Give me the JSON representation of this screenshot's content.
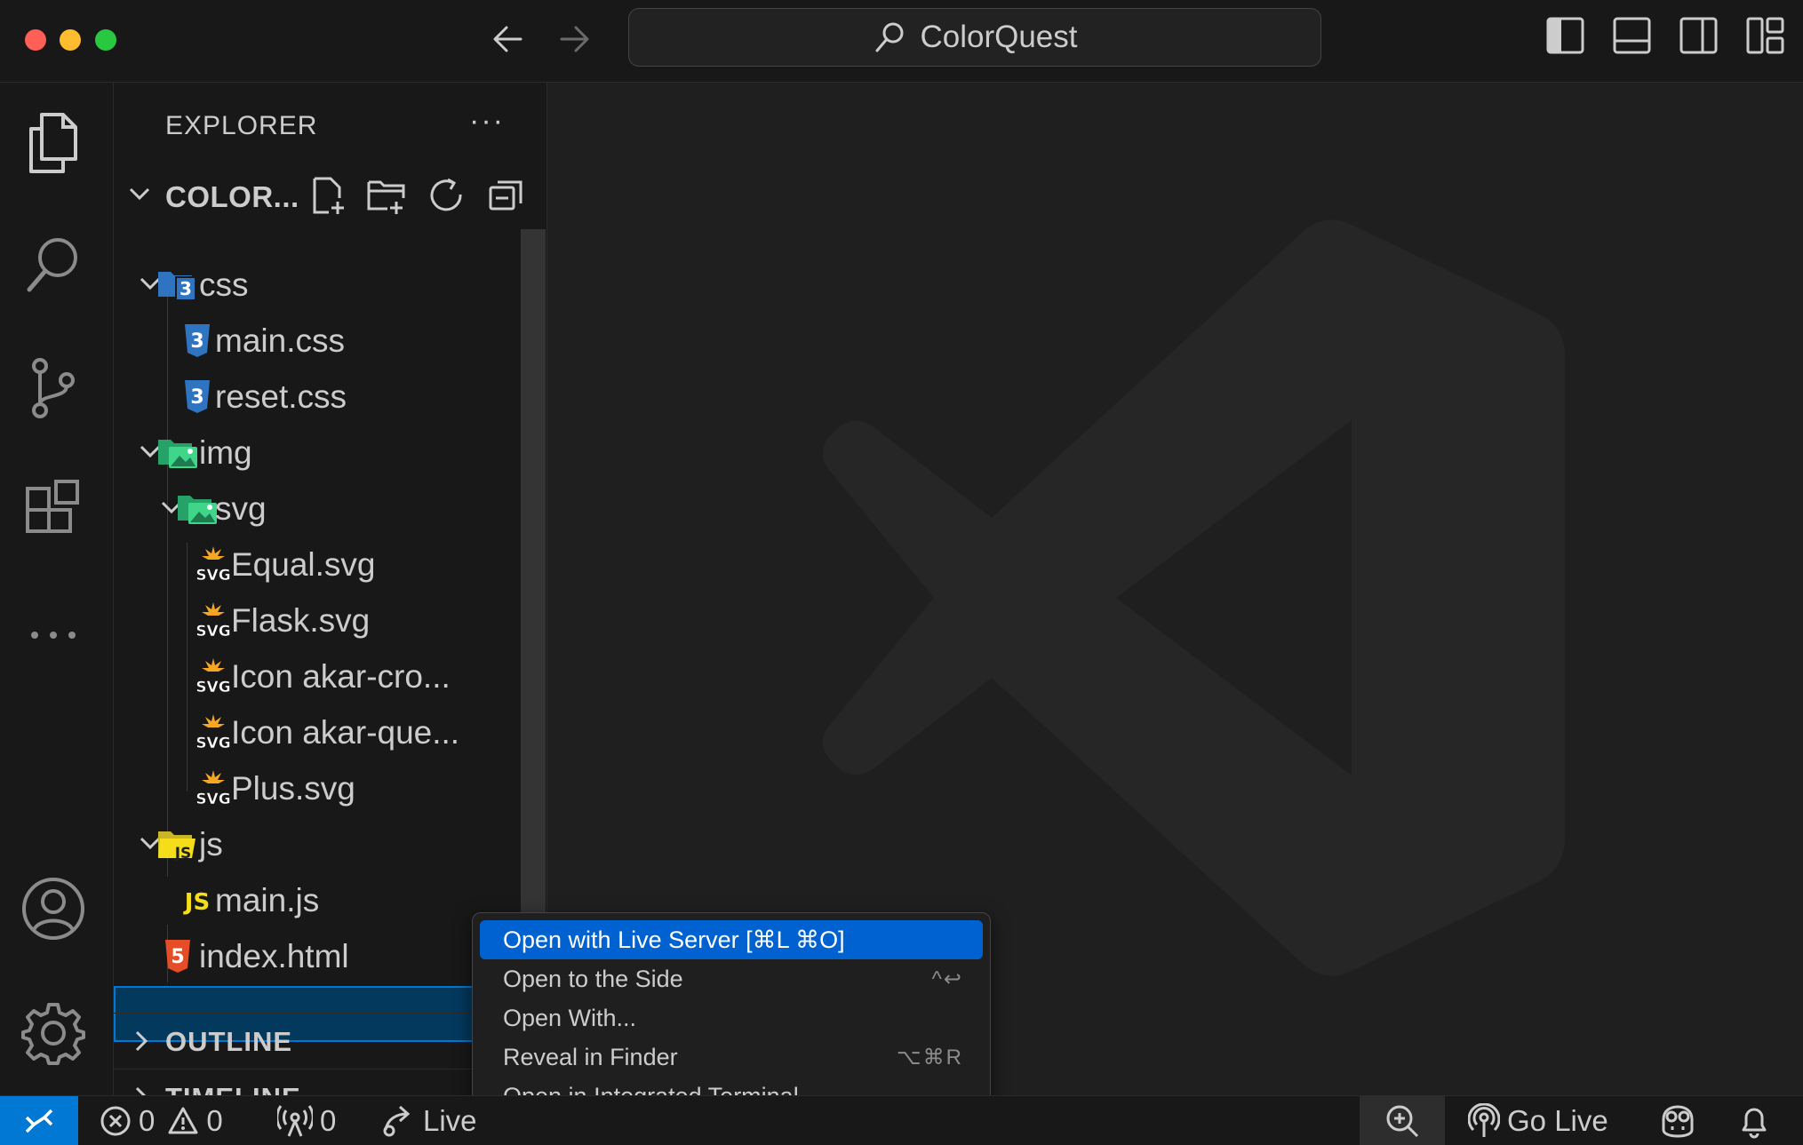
{
  "window": {
    "title": "ColorQuest"
  },
  "explorer": {
    "header": "EXPLORER",
    "more": "···",
    "root_folder": "COLOR...",
    "tree": [
      {
        "label": "css",
        "type": "folder"
      },
      {
        "label": "main.css",
        "type": "css"
      },
      {
        "label": "reset.css",
        "type": "css"
      },
      {
        "label": "img",
        "type": "folder"
      },
      {
        "label": "svg",
        "type": "folder"
      },
      {
        "label": "Equal.svg",
        "type": "svg"
      },
      {
        "label": "Flask.svg",
        "type": "svg"
      },
      {
        "label": "Icon akar-cro...",
        "type": "svg"
      },
      {
        "label": "Icon akar-que...",
        "type": "svg"
      },
      {
        "label": "Plus.svg",
        "type": "svg"
      },
      {
        "label": "js",
        "type": "folder"
      },
      {
        "label": "main.js",
        "type": "js"
      },
      {
        "label": "index.html",
        "type": "html",
        "selected": true
      }
    ],
    "sections": [
      {
        "label": "OUTLINE"
      },
      {
        "label": "TIMELINE"
      }
    ]
  },
  "icon_labels": {
    "css": "3",
    "svg": "SVG",
    "js": "JS",
    "html": "5"
  },
  "context_menu": {
    "items": [
      {
        "label": "Open with Live Server [⌘L ⌘O]",
        "shortcut": "",
        "highlighted": true
      },
      {
        "label": "Open to the Side",
        "shortcut": "^↩"
      },
      {
        "label": "Open With...",
        "shortcut": ""
      },
      {
        "label": "Reveal in Finder",
        "shortcut": "⌥⌘R"
      },
      {
        "label": "Open in Integrated Terminal",
        "shortcut": ""
      }
    ]
  },
  "statusbar": {
    "errors": "0",
    "warnings": "0",
    "ports": "0",
    "live_share": "Live",
    "go_live": "Go Live"
  },
  "colors": {
    "accent": "#0078d4",
    "menu_highlight": "#0062d1",
    "css_icon": "#2f74c0",
    "svg_icon": "#f5a623",
    "js_icon": "#f5de19",
    "html_icon": "#e44d26"
  }
}
